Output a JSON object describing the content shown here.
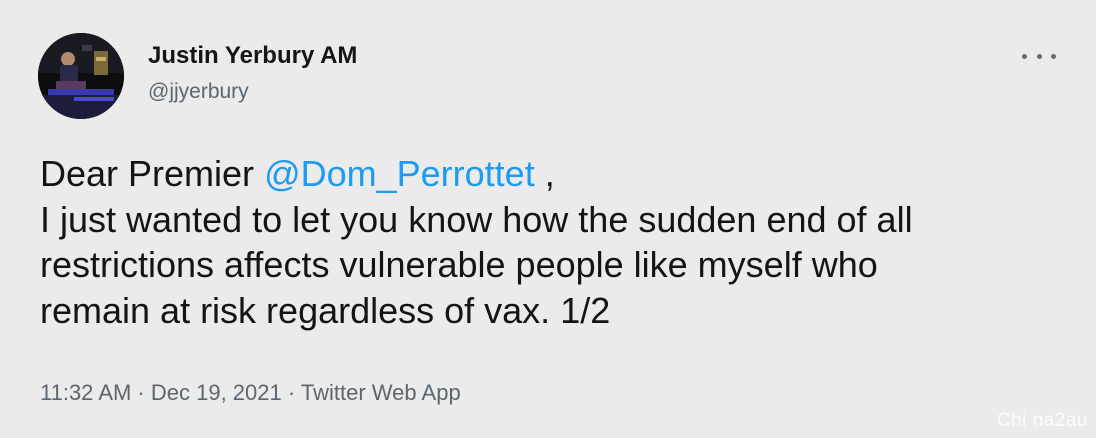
{
  "author": {
    "display_name": "Justin Yerbury AM",
    "handle": "@jjyerbury"
  },
  "tweet": {
    "line1_prefix": "Dear Premier ",
    "mention": "@Dom_Perrottet",
    "line1_suffix": " ,",
    "line2": "I just wanted to let you know how the sudden end of all",
    "line3": "restrictions affects vulnerable people like myself who",
    "line4": "remain at risk regardless of vax. 1/2"
  },
  "meta": {
    "text": "11:32 AM · Dec 19, 2021 · Twitter Web App"
  },
  "watermark": "Chi na2au",
  "icons": {
    "more": "more-options-icon",
    "avatar": "avatar"
  },
  "colors": {
    "background": "#ebebeb",
    "mention": "#1d9bf0",
    "secondary_text": "#5c6670"
  }
}
